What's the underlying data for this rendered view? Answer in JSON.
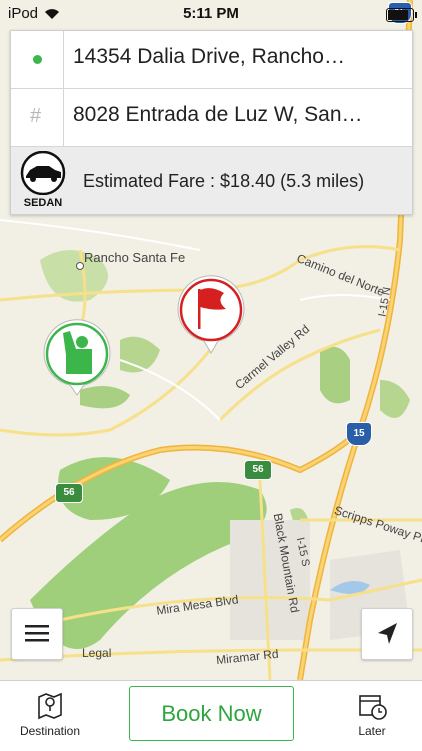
{
  "status_bar": {
    "carrier": "iPod",
    "time": "5:11 PM"
  },
  "pickup": {
    "address": "14354 Dalia Drive, Rancho…"
  },
  "dropoff": {
    "address": "8028 Entrada de Luz W, San…"
  },
  "fare": {
    "vehicle": "SEDAN",
    "text": "Estimated Fare : $18.40 (5.3 miles)"
  },
  "map": {
    "labels": {
      "rancho": "Rancho Santa Fe",
      "camino": "Camino del Norte",
      "carmel": "Carmel Valley Rd",
      "scripps": "Scripps Poway Pkwy",
      "black": "Black Mountain Rd",
      "mira": "Mira Mesa Blvd",
      "miramar": "Miramar Rd",
      "i15n": "I-15 N",
      "i15s": "I-15 S",
      "legal": "Legal",
      "hw56a": "56",
      "hw56b": "56",
      "i15": "15",
      "i15top": "15"
    },
    "pickup_icon": "hailing-person-icon",
    "dest_icon": "red-flag-icon"
  },
  "bottom": {
    "destination": "Destination",
    "book": "Book Now",
    "later": "Later"
  },
  "colors": {
    "accent_green": "#3cb54a",
    "flag_red": "#d62020"
  }
}
